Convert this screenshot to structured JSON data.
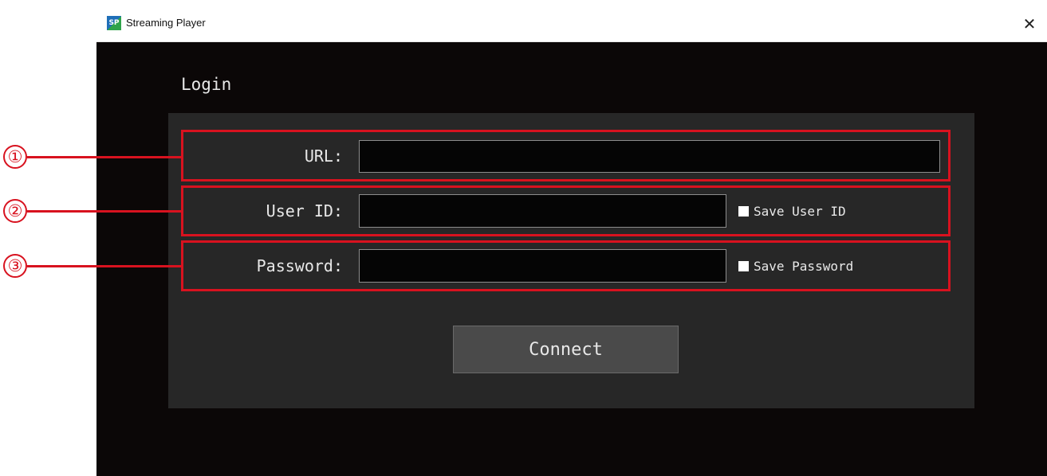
{
  "window": {
    "title": "Streaming Player",
    "app_icon_text": "SP",
    "close_glyph": "✕"
  },
  "login": {
    "heading": "Login",
    "url_label": "URL:",
    "url_value": "",
    "userid_label": "User ID:",
    "userid_value": "",
    "password_label": "Password:",
    "password_value": "",
    "save_userid_label": "Save User ID",
    "save_password_label": "Save Password",
    "connect_label": "Connect"
  },
  "callouts": [
    "①",
    "②",
    "③"
  ],
  "colors": {
    "highlight": "#d8121f",
    "window_bg": "#0b0707",
    "panel_bg": "#272727"
  }
}
